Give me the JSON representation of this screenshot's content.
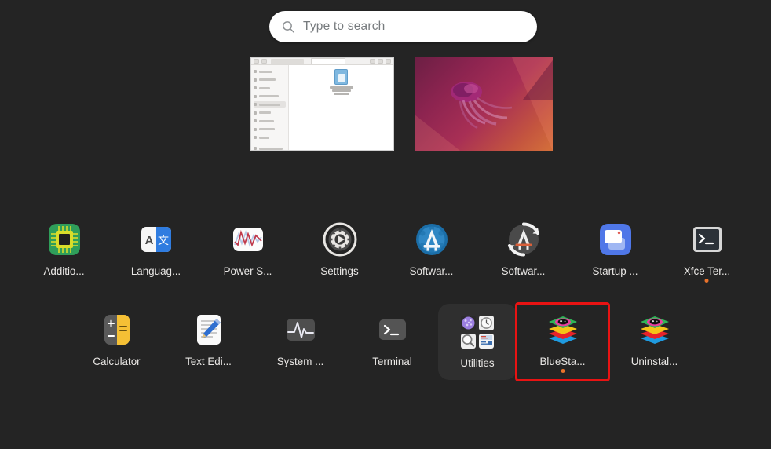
{
  "search": {
    "placeholder": "Type to search",
    "icon": "search-icon"
  },
  "windows": [
    {
      "name": "file-manager-window-thumbnail",
      "title": "Files"
    },
    {
      "name": "desktop-wallpaper-thumbnail",
      "title": "Desktop"
    }
  ],
  "app_grid": {
    "rows": [
      {
        "apps": [
          {
            "label": "Additio...",
            "icon": "chip-icon",
            "running": false
          },
          {
            "label": "Languag...",
            "icon": "language-translate-icon",
            "running": false
          },
          {
            "label": "Power S...",
            "icon": "power-statistics-icon",
            "running": false
          },
          {
            "label": "Settings",
            "icon": "gear-icon",
            "running": false
          },
          {
            "label": "Softwar...",
            "icon": "ubuntu-software-icon",
            "running": false
          },
          {
            "label": "Softwar...",
            "icon": "software-updater-icon",
            "running": false
          },
          {
            "label": "Startup ...",
            "icon": "startup-applications-icon",
            "running": false
          },
          {
            "label": "Xfce Ter...",
            "icon": "xfce-terminal-icon",
            "running": true
          }
        ]
      },
      {
        "apps": [
          {
            "label": "Calculator",
            "icon": "calculator-icon",
            "running": false
          },
          {
            "label": "Text Edi...",
            "icon": "text-editor-icon",
            "running": false
          },
          {
            "label": "System ...",
            "icon": "system-monitor-icon",
            "running": false
          },
          {
            "label": "Terminal",
            "icon": "terminal-icon",
            "running": false
          },
          {
            "label": "Utilities",
            "icon": "folder-utilities-icon",
            "running": false,
            "folder": true
          },
          {
            "label": "BlueSta...",
            "icon": "bluestacks-icon",
            "running": true,
            "highlighted": true
          },
          {
            "label": "Uninstal...",
            "icon": "bluestacks-uninstall-icon",
            "running": false
          }
        ]
      }
    ]
  },
  "colors": {
    "background": "#242424",
    "highlight_border": "#e81313",
    "running_dot": "#e8722b",
    "search_background": "#ffffff",
    "label_text": "#e9e7e5",
    "folder_background": "#2f2f2f"
  }
}
